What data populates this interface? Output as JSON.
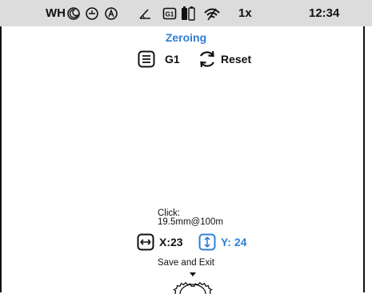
{
  "status_bar": {
    "profile": "WH",
    "icons": [
      "moon-icon",
      "timer-icon",
      "auto-mode-icon",
      "angle-icon",
      "g1-badge-icon",
      "battery-icon",
      "wifi-icon"
    ],
    "g1_badge": "G1",
    "zoom": "1x",
    "time": "12:34"
  },
  "title": "Zeroing",
  "toolbar": {
    "profile_icon": "list-icon",
    "profile": "G1",
    "reset_icon": "refresh-icon",
    "reset_label": "Reset"
  },
  "click": {
    "label": "Click:",
    "value": "19.5mm@100m"
  },
  "coords": {
    "x_icon": "horizontal-arrows-icon",
    "x_label": "X:23",
    "y_icon": "vertical-arrows-icon",
    "y_label": "Y: 24"
  },
  "save_exit": "Save and Exit",
  "accent_color": "#2f7fd6"
}
